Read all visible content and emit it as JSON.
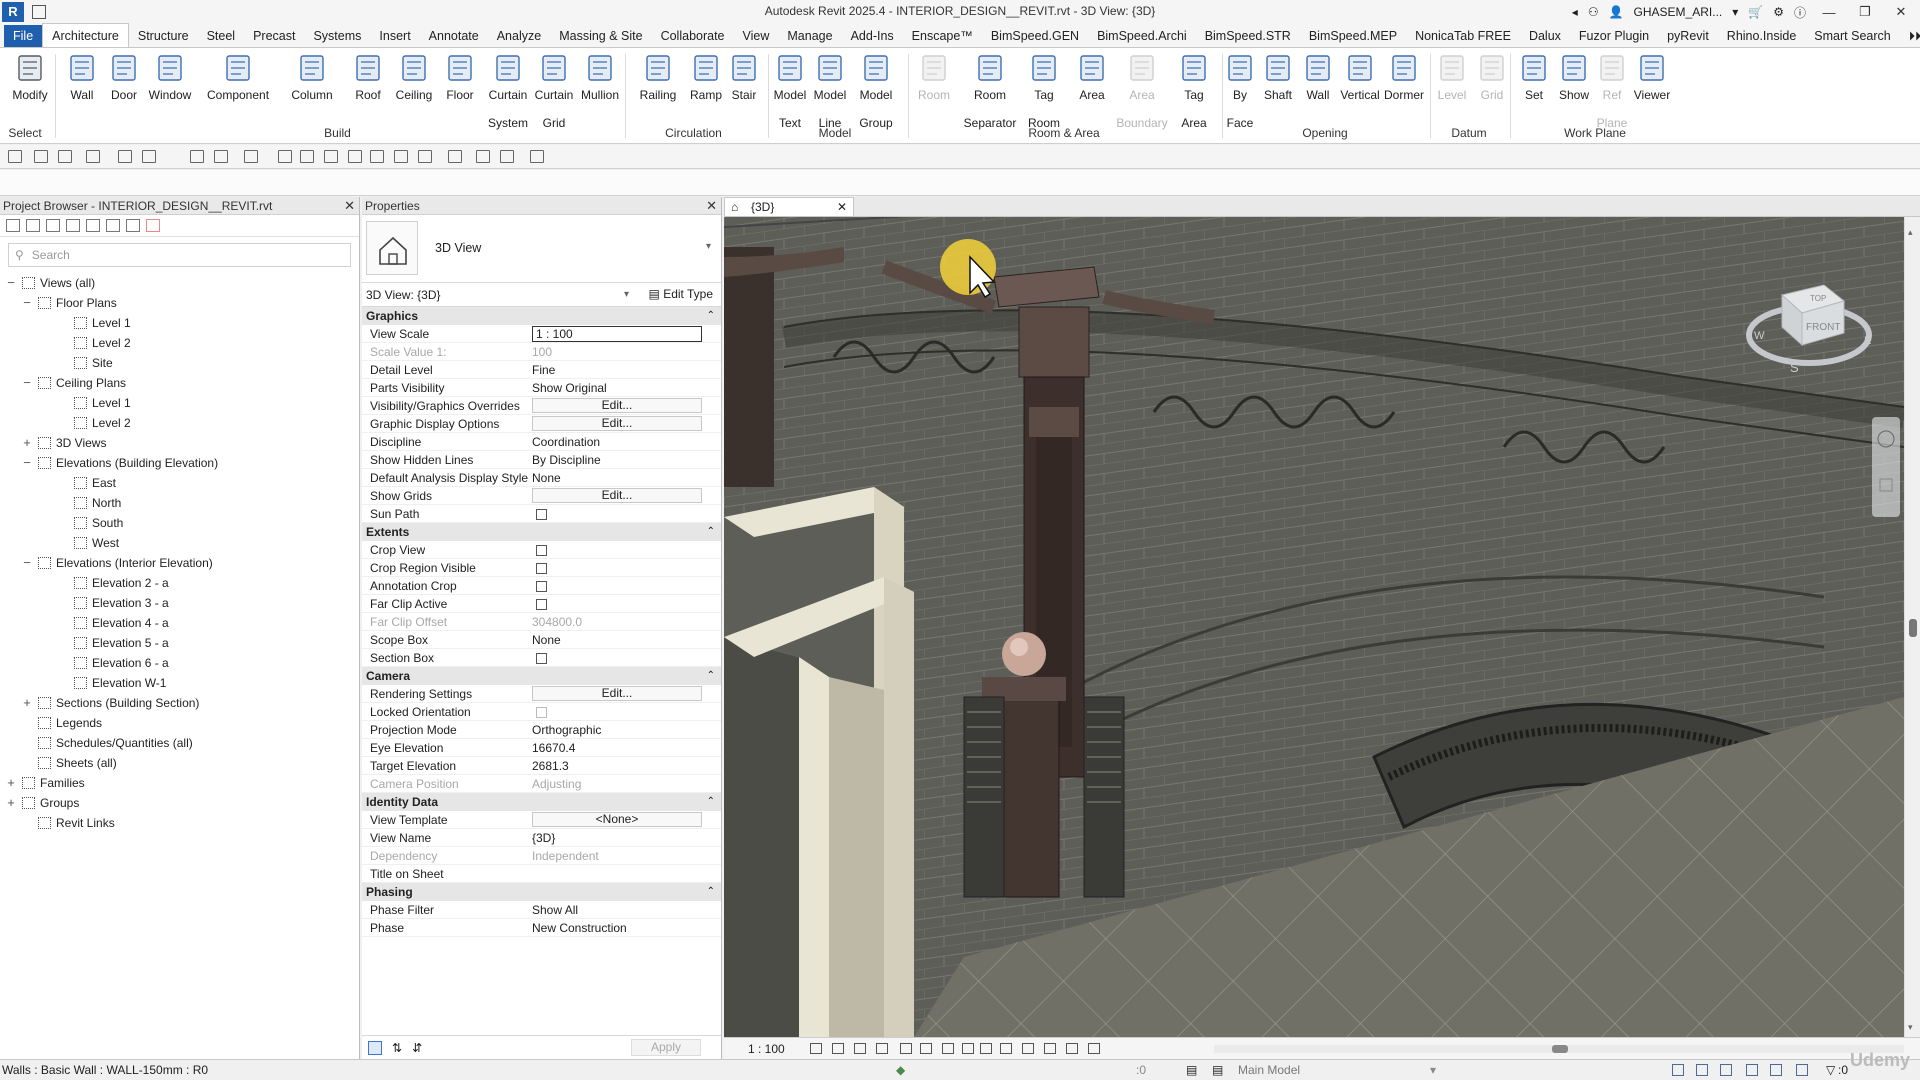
{
  "app": {
    "title": "Autodesk Revit 2025.4 - INTERIOR_DESIGN__REVIT.rvt - 3D View: {3D}",
    "user": "GHASEM_ARI...",
    "logo_letter": "R"
  },
  "tabs": [
    "File",
    "Architecture",
    "Structure",
    "Steel",
    "Precast",
    "Systems",
    "Insert",
    "Annotate",
    "Analyze",
    "Massing & Site",
    "Collaborate",
    "View",
    "Manage",
    "Add-Ins",
    "Enscape™",
    "BimSpeed.GEN",
    "BimSpeed.Archi",
    "BimSpeed.STR",
    "BimSpeed.MEP",
    "NonicaTab FREE",
    "Dalux",
    "Fuzor Plugin",
    "pyRevit",
    "Rhino.Inside",
    "Smart Search"
  ],
  "active_tab": "Architecture",
  "ribbon": {
    "tools": [
      {
        "l1": "Modify",
        "l2": ""
      },
      {
        "l1": "Wall",
        "l2": ""
      },
      {
        "l1": "Door",
        "l2": ""
      },
      {
        "l1": "Window",
        "l2": ""
      },
      {
        "l1": "Component",
        "l2": ""
      },
      {
        "l1": "Column",
        "l2": ""
      },
      {
        "l1": "Roof",
        "l2": ""
      },
      {
        "l1": "Ceiling",
        "l2": ""
      },
      {
        "l1": "Floor",
        "l2": ""
      },
      {
        "l1": "Curtain",
        "l2": "System"
      },
      {
        "l1": "Curtain",
        "l2": "Grid"
      },
      {
        "l1": "Mullion",
        "l2": ""
      },
      {
        "l1": "Railing",
        "l2": ""
      },
      {
        "l1": "Ramp",
        "l2": ""
      },
      {
        "l1": "Stair",
        "l2": ""
      },
      {
        "l1": "Model",
        "l2": "Text"
      },
      {
        "l1": "Model",
        "l2": "Line"
      },
      {
        "l1": "Model",
        "l2": "Group"
      },
      {
        "l1": "Room",
        "l2": ""
      },
      {
        "l1": "Room",
        "l2": "Separator"
      },
      {
        "l1": "Tag",
        "l2": "Room"
      },
      {
        "l1": "Area",
        "l2": ""
      },
      {
        "l1": "Area",
        "l2": "Boundary"
      },
      {
        "l1": "Tag",
        "l2": "Area"
      },
      {
        "l1": "By",
        "l2": "Face"
      },
      {
        "l1": "Shaft",
        "l2": ""
      },
      {
        "l1": "Wall",
        "l2": ""
      },
      {
        "l1": "Vertical",
        "l2": ""
      },
      {
        "l1": "Dormer",
        "l2": ""
      },
      {
        "l1": "Level",
        "l2": ""
      },
      {
        "l1": "Grid",
        "l2": ""
      },
      {
        "l1": "Set",
        "l2": ""
      },
      {
        "l1": "Show",
        "l2": ""
      },
      {
        "l1": "Ref",
        "l2": "Plane"
      },
      {
        "l1": "Viewer",
        "l2": ""
      }
    ],
    "groups": [
      "Select",
      "Build",
      "Circulation",
      "Model",
      "Room & Area",
      "Opening",
      "Datum",
      "Work Plane"
    ]
  },
  "project_browser": {
    "title": "Project Browser - INTERIOR_DESIGN__REVIT.rvt",
    "search_placeholder": "Search",
    "tree": [
      {
        "label": "Views (all)",
        "toggle": "−"
      },
      {
        "label": "Floor Plans",
        "toggle": "−"
      },
      {
        "label": "Level 1",
        "toggle": ""
      },
      {
        "label": "Level 2",
        "toggle": ""
      },
      {
        "label": "Site",
        "toggle": ""
      },
      {
        "label": "Ceiling Plans",
        "toggle": "−"
      },
      {
        "label": "Level 1",
        "toggle": ""
      },
      {
        "label": "Level 2",
        "toggle": ""
      },
      {
        "label": "3D Views",
        "toggle": "+"
      },
      {
        "label": "Elevations (Building Elevation)",
        "toggle": "−"
      },
      {
        "label": "East",
        "toggle": ""
      },
      {
        "label": "North",
        "toggle": ""
      },
      {
        "label": "South",
        "toggle": ""
      },
      {
        "label": "West",
        "toggle": ""
      },
      {
        "label": "Elevations (Interior Elevation)",
        "toggle": "−"
      },
      {
        "label": "Elevation 2 - a",
        "toggle": ""
      },
      {
        "label": "Elevation 3 - a",
        "toggle": ""
      },
      {
        "label": "Elevation 4 - a",
        "toggle": ""
      },
      {
        "label": "Elevation 5 - a",
        "toggle": ""
      },
      {
        "label": "Elevation 6 - a",
        "toggle": ""
      },
      {
        "label": "Elevation W-1",
        "toggle": ""
      },
      {
        "label": "Sections (Building Section)",
        "toggle": "+"
      },
      {
        "label": "Legends",
        "toggle": ""
      },
      {
        "label": "Schedules/Quantities (all)",
        "toggle": ""
      },
      {
        "label": "Sheets (all)",
        "toggle": ""
      },
      {
        "label": "Families",
        "toggle": "+"
      },
      {
        "label": "Groups",
        "toggle": "+"
      },
      {
        "label": "Revit Links",
        "toggle": ""
      }
    ]
  },
  "properties": {
    "title": "Properties",
    "type_name": "3D View",
    "selector": "3D View: {3D}",
    "edit_type": "Edit Type",
    "apply": "Apply",
    "sections": [
      {
        "name": "Graphics",
        "rows": [
          {
            "k": "View Scale",
            "v": "1 : 100",
            "kind": "input"
          },
          {
            "k": "Scale Value    1:",
            "v": "100",
            "kind": "dim"
          },
          {
            "k": "Detail Level",
            "v": "Fine",
            "kind": "text"
          },
          {
            "k": "Parts Visibility",
            "v": "Show Original",
            "kind": "text"
          },
          {
            "k": "Visibility/Graphics Overrides",
            "v": "Edit...",
            "kind": "button"
          },
          {
            "k": "Graphic Display Options",
            "v": "Edit...",
            "kind": "button"
          },
          {
            "k": "Discipline",
            "v": "Coordination",
            "kind": "text"
          },
          {
            "k": "Show Hidden Lines",
            "v": "By Discipline",
            "kind": "text"
          },
          {
            "k": "Default Analysis Display Style",
            "v": "None",
            "kind": "text"
          },
          {
            "k": "Show Grids",
            "v": "Edit...",
            "kind": "button"
          },
          {
            "k": "Sun Path",
            "v": "",
            "kind": "check"
          }
        ]
      },
      {
        "name": "Extents",
        "rows": [
          {
            "k": "Crop View",
            "v": "",
            "kind": "check"
          },
          {
            "k": "Crop Region Visible",
            "v": "",
            "kind": "check"
          },
          {
            "k": "Annotation Crop",
            "v": "",
            "kind": "check"
          },
          {
            "k": "Far Clip Active",
            "v": "",
            "kind": "check"
          },
          {
            "k": "Far Clip Offset",
            "v": "304800.0",
            "kind": "dim"
          },
          {
            "k": "Scope Box",
            "v": "None",
            "kind": "text"
          },
          {
            "k": "Section Box",
            "v": "",
            "kind": "check"
          }
        ]
      },
      {
        "name": "Camera",
        "rows": [
          {
            "k": "Rendering Settings",
            "v": "Edit...",
            "kind": "button"
          },
          {
            "k": "Locked Orientation",
            "v": "",
            "kind": "dimcheck"
          },
          {
            "k": "Projection Mode",
            "v": "Orthographic",
            "kind": "text"
          },
          {
            "k": "Eye Elevation",
            "v": "16670.4",
            "kind": "text"
          },
          {
            "k": "Target Elevation",
            "v": "2681.3",
            "kind": "text"
          },
          {
            "k": "Camera Position",
            "v": "Adjusting",
            "kind": "dim"
          }
        ]
      },
      {
        "name": "Identity Data",
        "rows": [
          {
            "k": "View Template",
            "v": "<None>",
            "kind": "button"
          },
          {
            "k": "View Name",
            "v": "{3D}",
            "kind": "text"
          },
          {
            "k": "Dependency",
            "v": "Independent",
            "kind": "dim"
          },
          {
            "k": "Title on Sheet",
            "v": "",
            "kind": "text"
          }
        ]
      },
      {
        "name": "Phasing",
        "rows": [
          {
            "k": "Phase Filter",
            "v": "Show All",
            "kind": "text"
          },
          {
            "k": "Phase",
            "v": "New Construction",
            "kind": "text"
          }
        ]
      }
    ]
  },
  "view": {
    "tab_label": "{3D}",
    "scale": "1 : 100",
    "viewcube_top": "TOP",
    "viewcube_front": "FRONT",
    "compass": [
      "W",
      "S",
      "E"
    ]
  },
  "status": {
    "message": "Walls : Basic Wall : WALL-150mm : R0",
    "workset": ":0",
    "model": "Main Model",
    "filter": ":0",
    "watermark": "Udemy"
  }
}
